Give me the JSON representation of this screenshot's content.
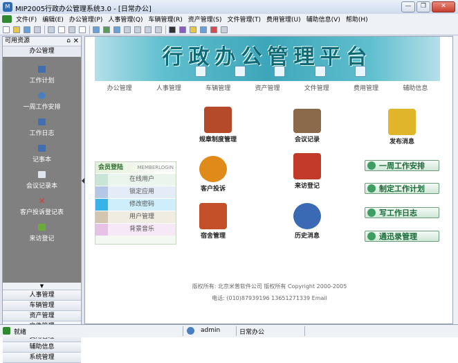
{
  "window": {
    "title": "MIP2005行政办公管理系统3.0 - [日常办公]",
    "buttons": {
      "minimize": "—",
      "restore": "❐",
      "close": "✕"
    }
  },
  "menubar": [
    "文件(F)",
    "编辑(E)",
    "办公管理(P)",
    "人事管理(Q)",
    "车辆管理(R)",
    "资产管理(S)",
    "文件管理(T)",
    "费用管理(U)",
    "辅助信息(V)",
    "帮助(H)"
  ],
  "left_panel": {
    "header": "可用资源",
    "pin_icon": "⌂",
    "close_icon": "✕",
    "current_group": "办公管理",
    "items": [
      {
        "label": "工作计划",
        "icon": "calendar-icon",
        "color": "#3f6fb0"
      },
      {
        "label": "一周工作安排",
        "icon": "person-icon",
        "color": "#4a7fbf"
      },
      {
        "label": "工作日志",
        "icon": "document-icon",
        "color": "#3f6fb0"
      },
      {
        "label": "记事本",
        "icon": "notebook-icon",
        "color": "#3f6fb0"
      },
      {
        "label": "会议记录本",
        "icon": "page-icon",
        "color": "#dfe6f2"
      },
      {
        "label": "客户投诉登记表",
        "icon": "red-x-icon",
        "color": "#e03a2a"
      },
      {
        "label": "来访登记",
        "icon": "visitor-icon",
        "color": "#6cab3a"
      }
    ],
    "more_arrow": "▼",
    "groups": [
      "人事管理",
      "车辆管理",
      "资产管理",
      "文件管理",
      "费用管理",
      "辅助信息",
      "系统管理"
    ]
  },
  "content": {
    "banner_title": "行政办公管理平台",
    "nav": [
      "办公管理",
      "人事管理",
      "车辆管理",
      "资产管理",
      "文件管理",
      "费用管理",
      "辅助信息"
    ],
    "features": [
      {
        "label": "规章制度管理",
        "icon": "bookshelf-icon",
        "color": "#b44a2a"
      },
      {
        "label": "会议记录",
        "icon": "handshake-icon",
        "color": "#8a6a4a"
      },
      {
        "label": "发布消息",
        "icon": "notepad-icon",
        "color": "#e0b52a"
      },
      {
        "label": "客户投诉",
        "icon": "gavel-icon",
        "color": "#e08a1a"
      },
      {
        "label": "来访登记",
        "icon": "house-icon",
        "color": "#c43a2a"
      },
      {
        "label": "宿舍管理",
        "icon": "dormitory-icon",
        "color": "#c4502a"
      },
      {
        "label": "历史消息",
        "icon": "globe-folder-icon",
        "color": "#3a6ab4"
      }
    ],
    "member_box": {
      "title": "会员登陆",
      "tag": "MEMBERLOGIN",
      "rows": [
        {
          "label": "在线用户",
          "color": "#c9e5d6"
        },
        {
          "label": "锁定应用",
          "color": "#b4c8e6"
        },
        {
          "label": "修改密码",
          "color": "#36b4e8"
        },
        {
          "label": "用户管理",
          "color": "#d2c6b0"
        },
        {
          "label": "背景音乐",
          "color": "#e6c2e6"
        }
      ]
    },
    "right_buttons": [
      "一周工作安排",
      "制定工作计划",
      "写工作日志",
      "通迅录管理"
    ],
    "footer": {
      "line1": "版权所有: 北京米普软件公司 版权所有 Copyright 2000-2005",
      "line2": "电话: (010)87939196   13651271339     Email"
    }
  },
  "statusbar": {
    "ready": "就绪",
    "user": "admin",
    "module": "日常办公"
  }
}
